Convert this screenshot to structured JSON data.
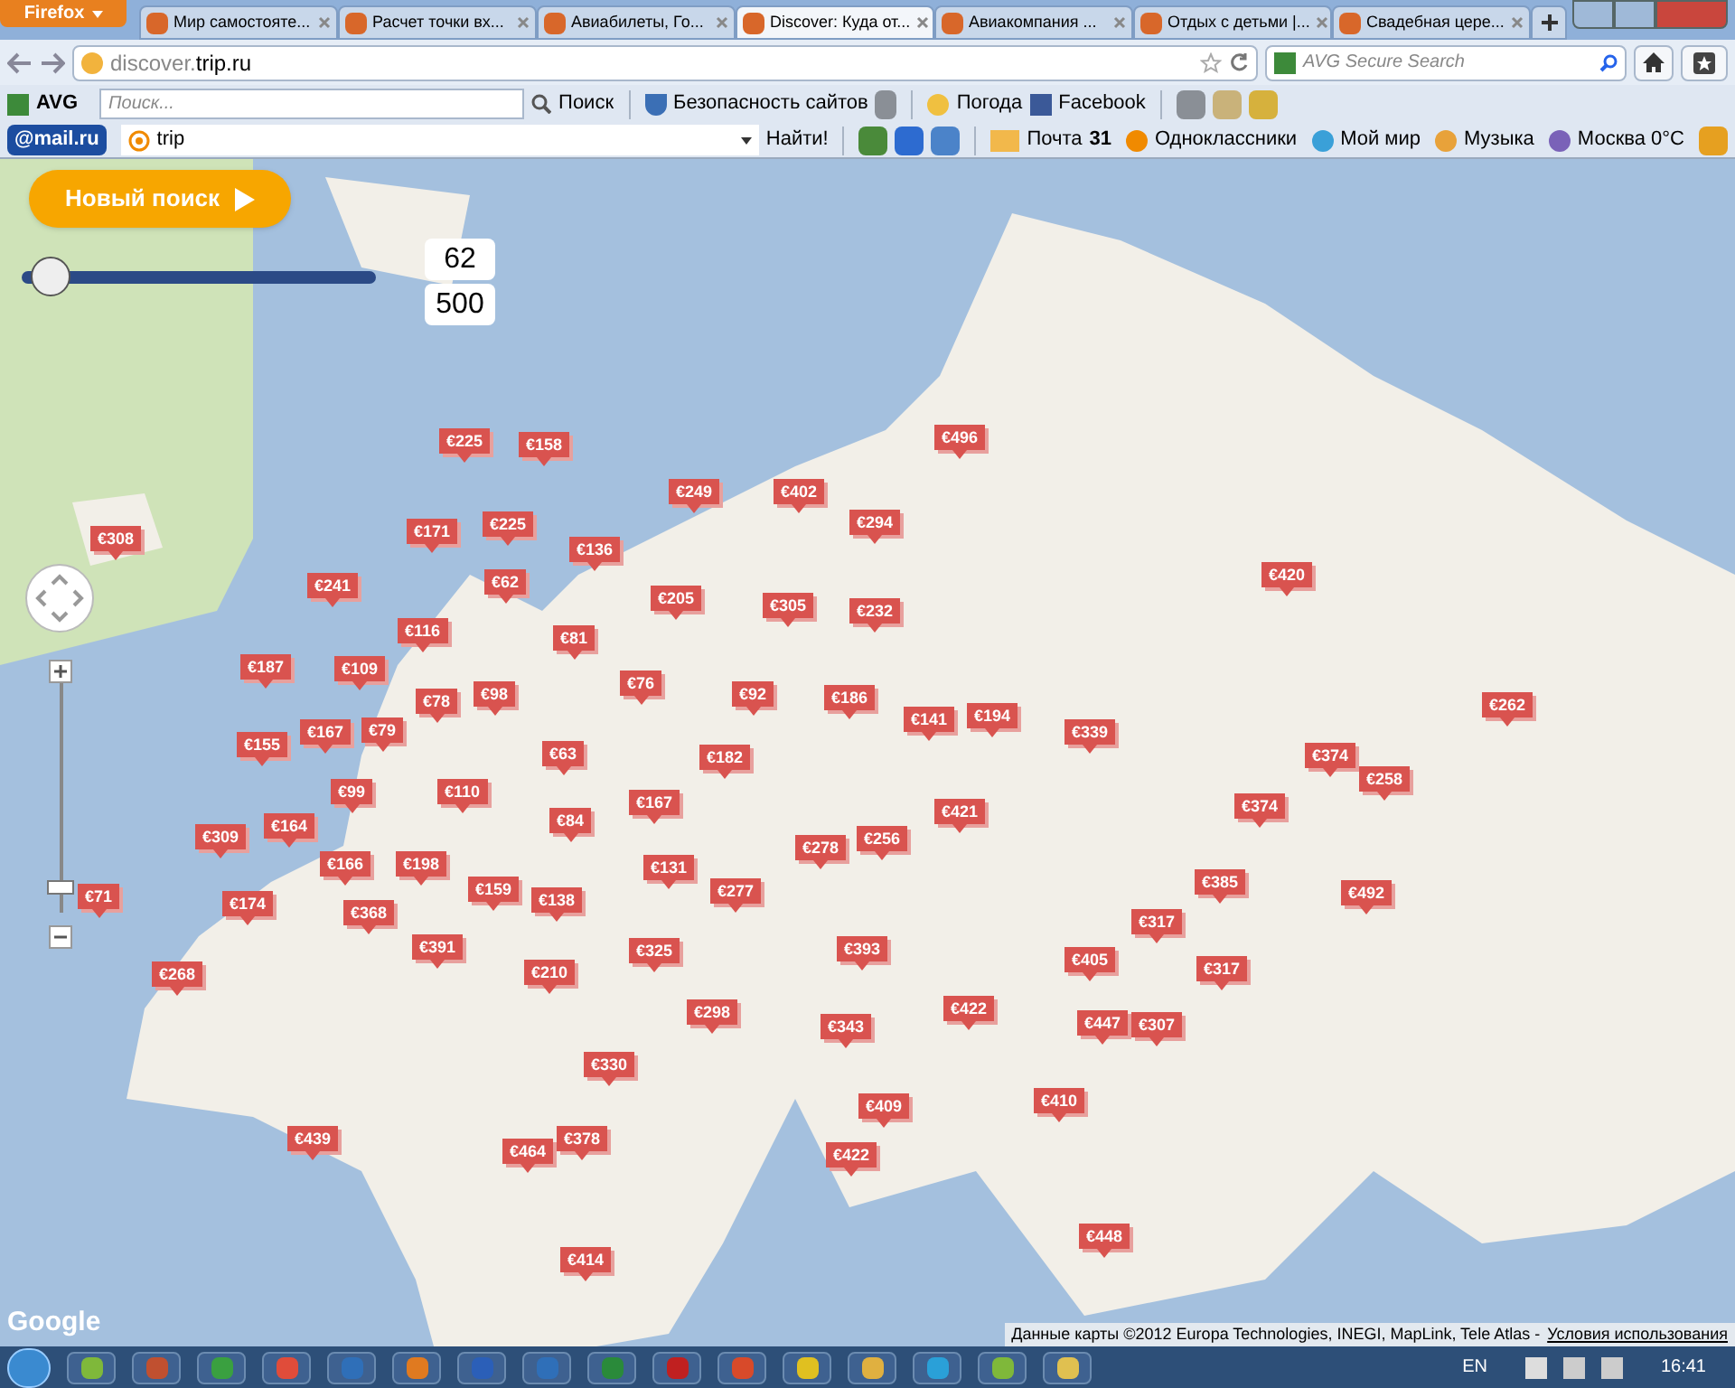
{
  "browser": {
    "menu_button": "Firefox",
    "tabs": [
      {
        "title": "Мир самостояте...",
        "selected": false
      },
      {
        "title": "Расчет точки вх...",
        "selected": false
      },
      {
        "title": "Авиабилеты, Го...",
        "selected": false
      },
      {
        "title": "Discover: Куда от...",
        "selected": true
      },
      {
        "title": "Авиакомпания ...",
        "selected": false
      },
      {
        "title": "Отдых с детьми |...",
        "selected": false
      },
      {
        "title": "Свадебная цере...",
        "selected": false
      }
    ],
    "address": {
      "subdomain": "discover.",
      "domain": "trip.ru"
    },
    "search": {
      "placeholder": "AVG Secure Search"
    }
  },
  "avg_toolbar": {
    "brand": "AVG",
    "search_placeholder": "Поиск...",
    "search_button": "Поиск",
    "items": [
      "Безопасность сайтов",
      "Погода",
      "Facebook"
    ]
  },
  "mail_toolbar": {
    "brand": "@mail.ru",
    "query": "trip",
    "find_button": "Найти!",
    "mail": {
      "label": "Почта",
      "count": "31"
    },
    "items": [
      "Одноклассники",
      "Мой мир",
      "Музыка",
      "Москва 0°C"
    ]
  },
  "page": {
    "new_search_button": "Новый поиск",
    "price_filter": {
      "level": 0.03,
      "min_value": "62",
      "max_value": "500"
    },
    "pins": [
      {
        "price": "€225"
      },
      {
        "price": "€158"
      },
      {
        "price": "€496"
      },
      {
        "price": "€249"
      },
      {
        "price": "€402"
      },
      {
        "price": "€308"
      },
      {
        "price": "€171"
      },
      {
        "price": "€225"
      },
      {
        "price": "€294"
      },
      {
        "price": "€136"
      },
      {
        "price": "€420"
      },
      {
        "price": "€241"
      },
      {
        "price": "€62"
      },
      {
        "price": "€205"
      },
      {
        "price": "€305"
      },
      {
        "price": "€116"
      },
      {
        "price": "€232"
      },
      {
        "price": "€81"
      },
      {
        "price": "€187"
      },
      {
        "price": "€109"
      },
      {
        "price": "€76"
      },
      {
        "price": "€78"
      },
      {
        "price": "€98"
      },
      {
        "price": "€92"
      },
      {
        "price": "€186"
      },
      {
        "price": "€141"
      },
      {
        "price": "€194"
      },
      {
        "price": "€262"
      },
      {
        "price": "€155"
      },
      {
        "price": "€167"
      },
      {
        "price": "€79"
      },
      {
        "price": "€63"
      },
      {
        "price": "€182"
      },
      {
        "price": "€339"
      },
      {
        "price": "€374"
      },
      {
        "price": "€258"
      },
      {
        "price": "€99"
      },
      {
        "price": "€110"
      },
      {
        "price": "€167"
      },
      {
        "price": "€421"
      },
      {
        "price": "€374"
      },
      {
        "price": "€309"
      },
      {
        "price": "€164"
      },
      {
        "price": "€84"
      },
      {
        "price": "€256"
      },
      {
        "price": "€166"
      },
      {
        "price": "€198"
      },
      {
        "price": "€131"
      },
      {
        "price": "€278"
      },
      {
        "price": "€71"
      },
      {
        "price": "€174"
      },
      {
        "price": "€159"
      },
      {
        "price": "€138"
      },
      {
        "price": "€277"
      },
      {
        "price": "€385"
      },
      {
        "price": "€492"
      },
      {
        "price": "€368"
      },
      {
        "price": "€317"
      },
      {
        "price": "€391"
      },
      {
        "price": "€325"
      },
      {
        "price": "€393"
      },
      {
        "price": "€405"
      },
      {
        "price": "€317"
      },
      {
        "price": "€268"
      },
      {
        "price": "€210"
      },
      {
        "price": "€298"
      },
      {
        "price": "€343"
      },
      {
        "price": "€422"
      },
      {
        "price": "€447"
      },
      {
        "price": "€307"
      },
      {
        "price": "€330"
      },
      {
        "price": "€409"
      },
      {
        "price": "€410"
      },
      {
        "price": "€439"
      },
      {
        "price": "€464"
      },
      {
        "price": "€378"
      },
      {
        "price": "€422"
      },
      {
        "price": "€448"
      },
      {
        "price": "€414"
      }
    ],
    "map_logo": "Google",
    "attribution": "Данные карты ©2012 Europa Technologies, INEGI, MapLink, Tele Atlas -",
    "terms_link": "Условия использования"
  },
  "taskbar": {
    "language": "EN",
    "time": "16:41"
  }
}
